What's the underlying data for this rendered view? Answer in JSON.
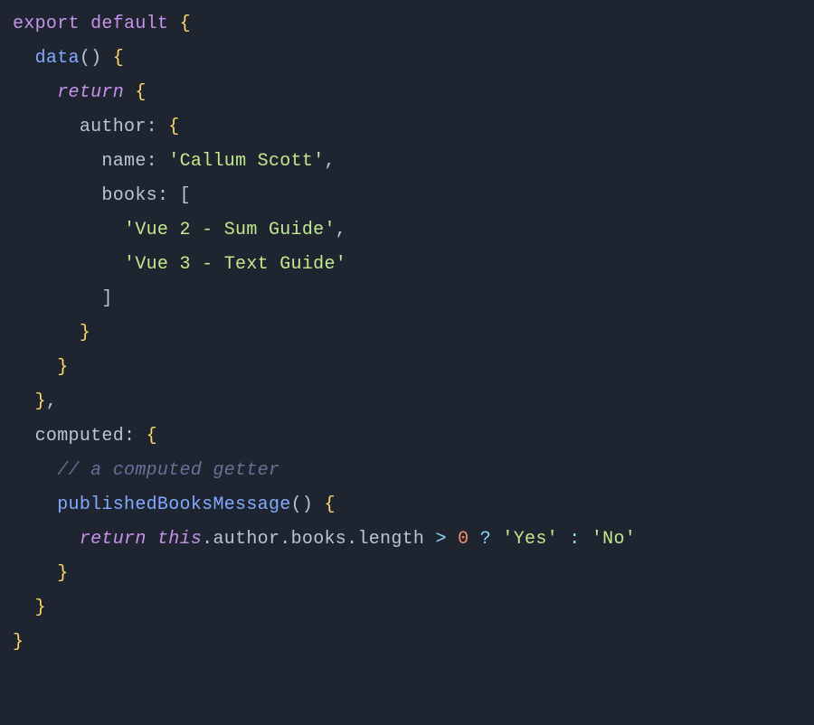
{
  "code": {
    "kw_export": "export",
    "kw_default": "default",
    "kw_return": "return",
    "kw_this": "this",
    "method_data": "data",
    "prop_author": "author",
    "prop_name": "name",
    "prop_books": "books",
    "str_name_val": "'Callum Scott'",
    "str_book1": "'Vue 2 - Sum Guide'",
    "str_book2": "'Vue 3 - Text Guide'",
    "prop_computed": "computed",
    "comment_getter": "// a computed getter",
    "method_published": "publishedBooksMessage",
    "prop_author2": "author",
    "prop_books2": "books",
    "prop_length": "length",
    "op_gt": ">",
    "num_zero": "0",
    "op_ternary_q": "?",
    "str_yes": "'Yes'",
    "op_ternary_c": ":",
    "str_no": "'No'",
    "brace_open": "{",
    "brace_close": "}",
    "bracket_open": "[",
    "bracket_close": "]",
    "paren_open": "(",
    "paren_close": ")",
    "colon": ":",
    "comma": ",",
    "dot": "."
  }
}
